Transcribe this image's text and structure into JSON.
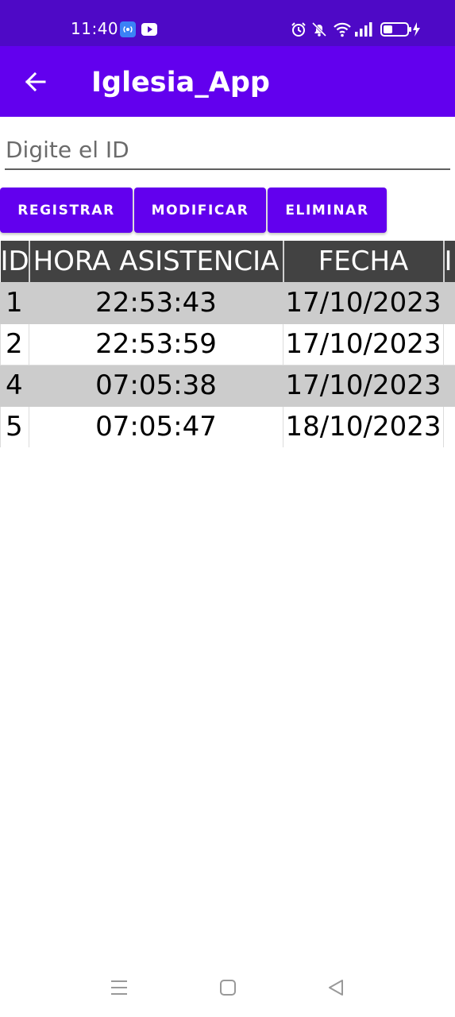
{
  "status_bar": {
    "time": "11:40",
    "left_icons": [
      "hotspot-icon",
      "youtube-icon"
    ],
    "right_icons": [
      "alarm-icon",
      "bell-off-icon",
      "wifi-icon",
      "signal-icon",
      "battery-charging-icon"
    ]
  },
  "app_bar": {
    "title": "Iglesia_App",
    "back_icon": "arrow-left-icon"
  },
  "search": {
    "placeholder": "Digite el ID",
    "value": ""
  },
  "buttons": {
    "registrar": "REGISTRAR",
    "modificar": "MODIFICAR",
    "eliminar": "ELIMINAR"
  },
  "table": {
    "headers": [
      "ID",
      "HORA ASISTENCIA",
      "FECHA",
      "I"
    ],
    "rows": [
      [
        "1",
        "22:53:43",
        "17/10/2023",
        ""
      ],
      [
        "2",
        "22:53:59",
        "17/10/2023",
        ""
      ],
      [
        "4",
        "07:05:38",
        "17/10/2023",
        ""
      ],
      [
        "5",
        "07:05:47",
        "18/10/2023",
        ""
      ]
    ]
  },
  "nav_bar": {
    "icons": [
      "recents-icon",
      "home-icon",
      "back-triangle-icon"
    ]
  },
  "colors": {
    "status_bar": "#4e09c6",
    "app_bar": "#6200ee",
    "button": "#6200ee",
    "table_header": "#424242",
    "row_shade": "#cccccc"
  }
}
